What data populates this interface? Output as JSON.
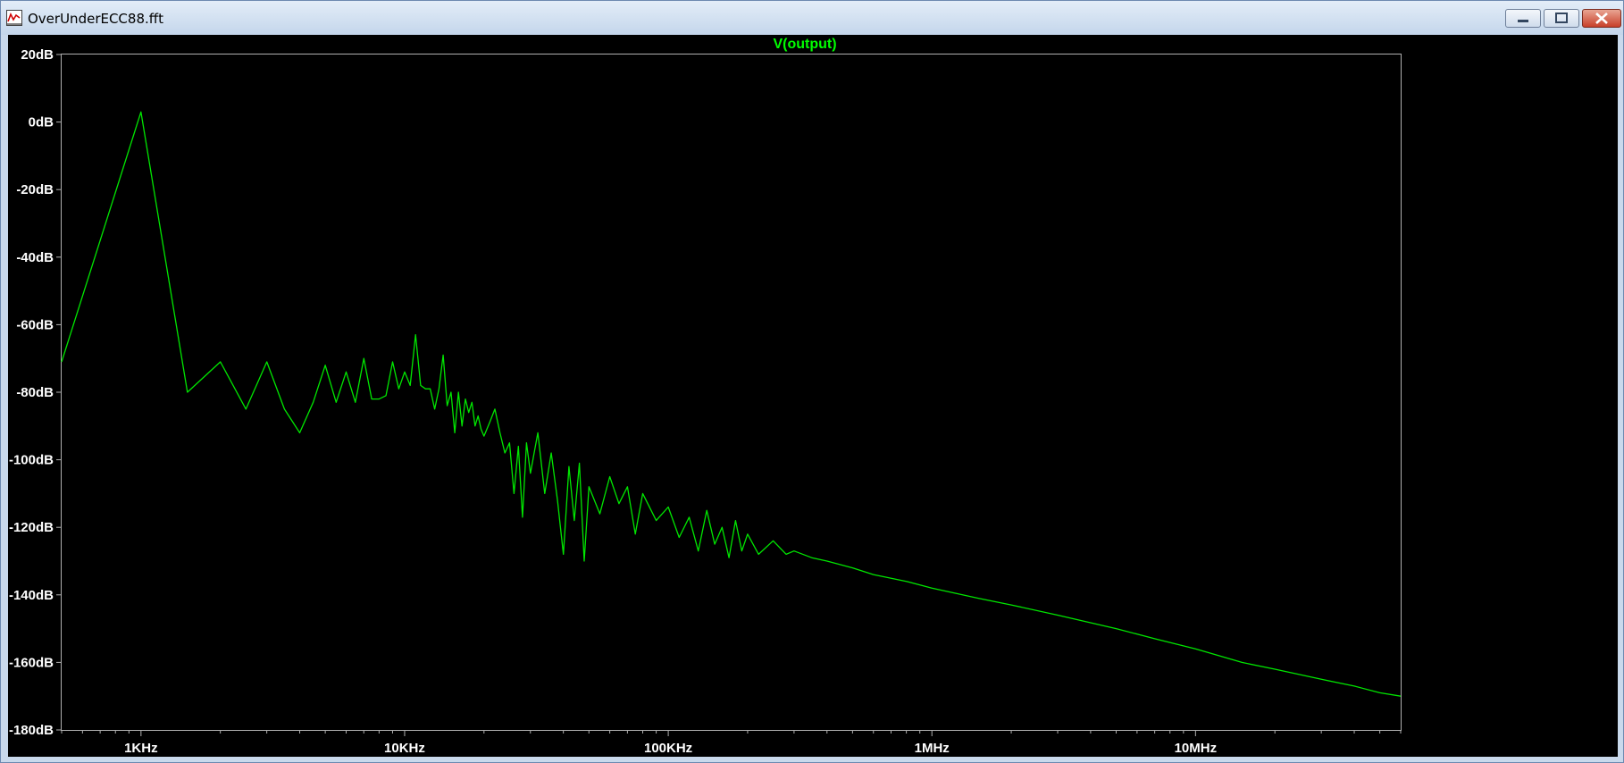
{
  "window": {
    "title": "OverUnderECC88.fft",
    "icon": "waveform-plot-icon",
    "buttons": {
      "minimize": "minimize-icon",
      "maximize": "maximize-icon",
      "close": "close-icon"
    }
  },
  "colors": {
    "trace": "#00e600",
    "title": "#00ff00",
    "axis": "#b0b0b0",
    "tick_label": "#ffffff",
    "background": "#000000",
    "window_chrome": "#c9d9ec",
    "close_button": "#c8402a"
  },
  "chart_data": {
    "type": "line",
    "title": "V(output)",
    "xlabel": "",
    "ylabel": "",
    "x_scale": "log",
    "xlim_hz": [
      500,
      60000000
    ],
    "ylim_db": [
      -180,
      20
    ],
    "yticks": [
      20,
      0,
      -20,
      -40,
      -60,
      -80,
      -100,
      -120,
      -140,
      -160,
      -180
    ],
    "ytick_labels": [
      "20dB",
      "0dB",
      "-20dB",
      "-40dB",
      "-60dB",
      "-80dB",
      "-100dB",
      "-120dB",
      "-140dB",
      "-160dB",
      "-180dB"
    ],
    "xticks_hz": [
      1000,
      10000,
      100000,
      1000000,
      10000000
    ],
    "xtick_labels": [
      "1KHz",
      "10KHz",
      "100KHz",
      "1MHz",
      "10MHz"
    ],
    "grid": false,
    "series": [
      {
        "name": "V(output)",
        "x_hz": [
          500,
          1000,
          1500,
          2000,
          2500,
          3000,
          3500,
          4000,
          4500,
          5000,
          5500,
          6000,
          6500,
          7000,
          7500,
          8000,
          8500,
          9000,
          9500,
          10000,
          10500,
          11000,
          11500,
          12000,
          12500,
          13000,
          13500,
          14000,
          14500,
          15000,
          15500,
          16000,
          16500,
          17000,
          17500,
          18000,
          18500,
          19000,
          19500,
          20000,
          21000,
          22000,
          23000,
          24000,
          25000,
          26000,
          27000,
          28000,
          29000,
          30000,
          32000,
          34000,
          36000,
          38000,
          40000,
          42000,
          44000,
          46000,
          48000,
          50000,
          55000,
          60000,
          65000,
          70000,
          75000,
          80000,
          90000,
          100000,
          110000,
          120000,
          130000,
          140000,
          150000,
          160000,
          170000,
          180000,
          190000,
          200000,
          220000,
          250000,
          280000,
          300000,
          350000,
          400000,
          500000,
          600000,
          800000,
          1000000,
          1500000,
          2000000,
          3000000,
          5000000,
          7000000,
          10000000,
          15000000,
          20000000,
          30000000,
          40000000,
          50000000,
          60000000
        ],
        "y_db": [
          -71,
          3,
          -80,
          -71,
          -85,
          -71,
          -85,
          -92,
          -83,
          -72,
          -83,
          -74,
          -83,
          -70,
          -82,
          -82,
          -81,
          -71,
          -79,
          -74,
          -78,
          -63,
          -78,
          -79,
          -79,
          -85,
          -79,
          -69,
          -84,
          -80,
          -92,
          -80,
          -90,
          -82,
          -86,
          -83,
          -90,
          -87,
          -91,
          -93,
          -89,
          -85,
          -92,
          -98,
          -95,
          -110,
          -96,
          -117,
          -95,
          -104,
          -92,
          -110,
          -98,
          -112,
          -128,
          -102,
          -118,
          -101,
          -130,
          -108,
          -116,
          -105,
          -113,
          -108,
          -122,
          -110,
          -118,
          -114,
          -123,
          -117,
          -127,
          -115,
          -125,
          -120,
          -129,
          -118,
          -127,
          -122,
          -128,
          -124,
          -128,
          -127,
          -129,
          -130,
          -132,
          -134,
          -136,
          -138,
          -141,
          -143,
          -146,
          -150,
          -153,
          -156,
          -160,
          -162,
          -165,
          -167,
          -169,
          -170
        ]
      }
    ]
  }
}
